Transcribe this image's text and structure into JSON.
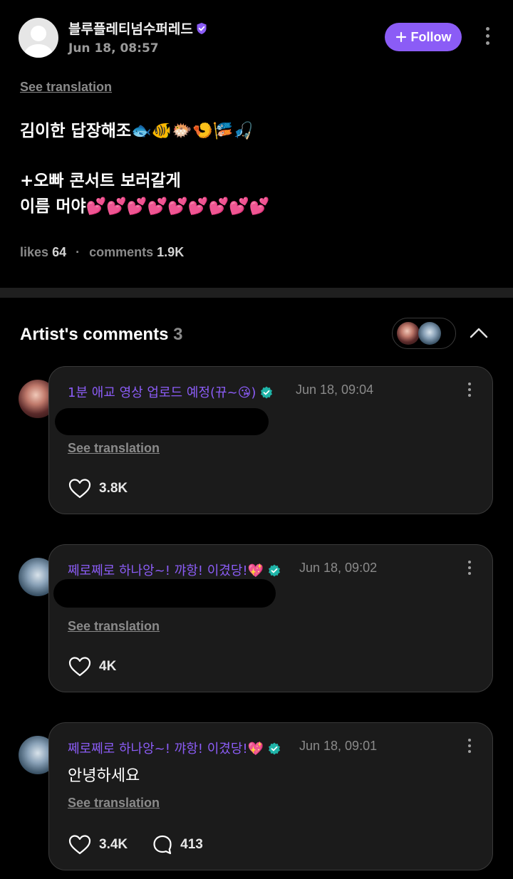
{
  "post": {
    "username": "블루플레티넘수퍼레드",
    "timestamp": "Jun 18, 08:57",
    "follow_label": "Follow",
    "see_translation": "See translation",
    "body_line1": "김이한 답장해조🐟🐠🐡🍤🎏🎣",
    "body_line2": "+오빠 콘서트 보러갈게",
    "body_line3": "이름 머야💕💕💕💕💕💕💕💕💕",
    "likes_label": "likes",
    "likes_count": "64",
    "comments_label": "comments",
    "comments_count": "1.9K"
  },
  "artist_section": {
    "title": "Artist's comments",
    "count": "3"
  },
  "comments": [
    {
      "author": "1분 애교 영상 업로드 예정(뀨~😘)",
      "timestamp": "Jun 18, 09:04",
      "text": "",
      "see_translation": "See translation",
      "likes": "3.8K"
    },
    {
      "author": "쩨로쩨로 하나앙~! 꺄항! 이겼당!💖",
      "timestamp": "Jun 18, 09:02",
      "text": "",
      "see_translation": "See translation",
      "likes": "4K"
    },
    {
      "author": "쩨로쩨로 하나앙~! 꺄항! 이겼당!💖",
      "timestamp": "Jun 18, 09:01",
      "text": "안녕하세요",
      "see_translation": "See translation",
      "likes": "3.4K",
      "replies": "413"
    }
  ],
  "colors": {
    "accent_purple": "#8b5cf6",
    "badge_teal": "#1fb4a8",
    "card_bg": "#1b1b1b",
    "background": "#000000"
  },
  "icons": [
    "default-avatar-icon",
    "verified-badge-icon",
    "plus-icon",
    "more-vertical-icon",
    "chevron-up-icon",
    "heart-icon",
    "comment-bubble-icon"
  ]
}
